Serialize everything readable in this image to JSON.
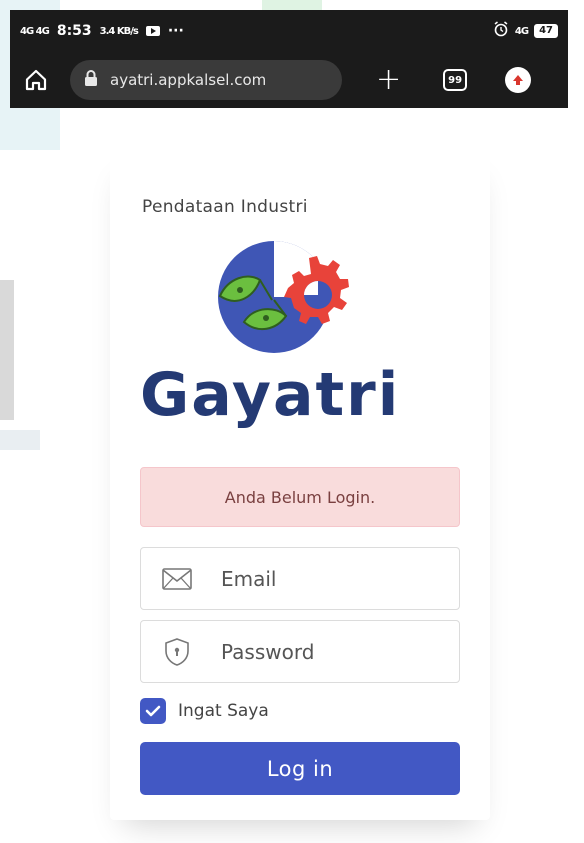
{
  "status_bar": {
    "signal": "4G 4G",
    "time": "8:53",
    "data_rate": "3.4 KB/s",
    "more": "···",
    "network": "4G",
    "battery": "47"
  },
  "browser": {
    "url": "ayatri.appkalsel.com",
    "tab_count": "99"
  },
  "page": {
    "subtitle": "Pendataan Industri",
    "brand": "Gayatri",
    "alert": "Anda Belum Login.",
    "email_placeholder": "Email",
    "password_placeholder": "Password",
    "remember_label": "Ingat Saya",
    "remember_checked": true,
    "login_label": "Log in"
  },
  "colors": {
    "brand_blue": "#243a74",
    "button_blue": "#4258c4",
    "logo_red": "#e8433a",
    "logo_green": "#6bbf3f",
    "alert_bg": "#f9dcdc"
  }
}
